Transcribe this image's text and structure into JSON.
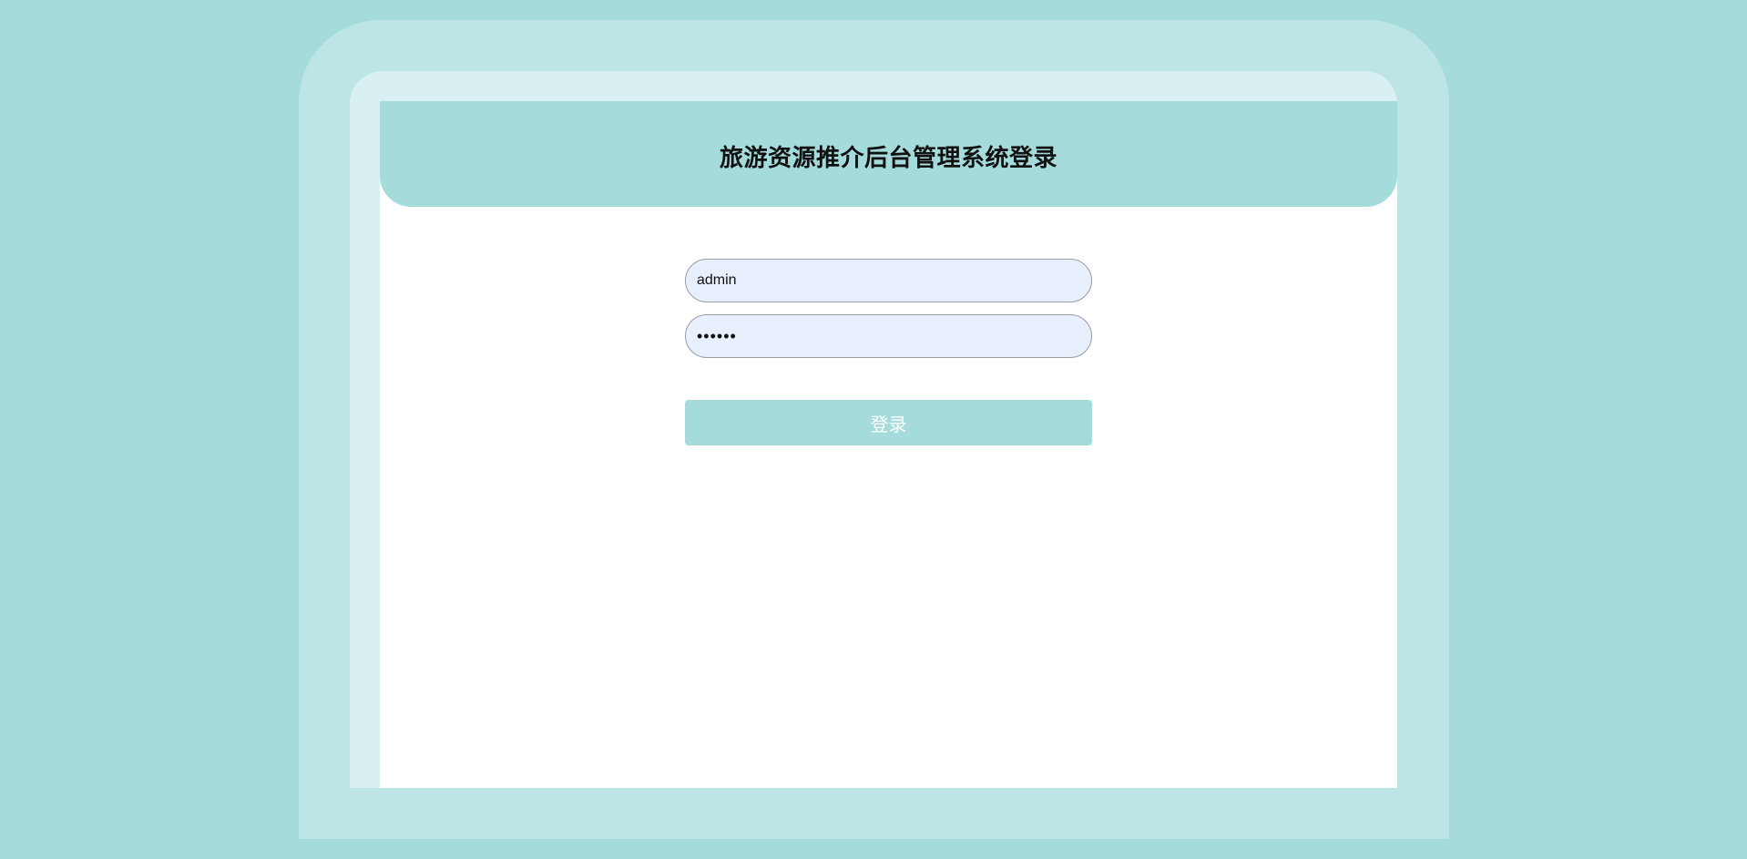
{
  "header": {
    "title": "旅游资源推介后台管理系统登录"
  },
  "form": {
    "username": {
      "value": "admin"
    },
    "password": {
      "value": "123456"
    },
    "submit_label": "登录"
  },
  "colors": {
    "accent": "#a5dcdb",
    "frame_outer": "#bee5e6",
    "frame_inner": "#d9f0f2",
    "input_background": "#e8f0fd"
  }
}
